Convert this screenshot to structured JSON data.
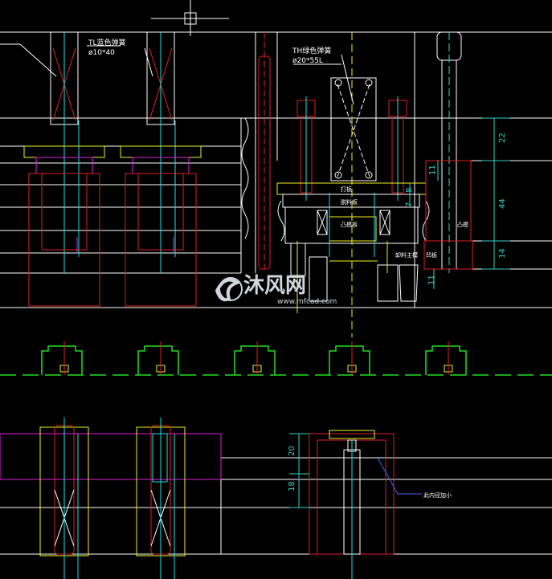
{
  "annotations": {
    "tl_spring": "TL蓝色弹簧",
    "tl_spec": "ø10*40",
    "th_spring": "TH绿色弹簧",
    "th_spec": "ø20*55L"
  },
  "dimensions": {
    "d22": "22",
    "d11": "11",
    "d7": "7",
    "d8": "8",
    "d44": "44",
    "d14": "14",
    "d11b": "11",
    "d20": "20",
    "d18": "18"
  },
  "labels": {
    "plate_top": "打板",
    "plate_mid": "脱料板",
    "plate_low": "凸模板",
    "punch": "凸模",
    "stripper_main": "卸料主模",
    "plate_side": "凹板",
    "note": "此内径加小"
  },
  "watermark": {
    "brand": "沐风网",
    "url": "www.mfcad.com"
  },
  "colors": {
    "background": "#000000",
    "white": "#ffffff",
    "red": "#e02020",
    "yellow": "#f0f020",
    "cyan": "#20e0e0",
    "green": "#20e020",
    "magenta": "#e020e0",
    "blue": "#4060ff"
  }
}
